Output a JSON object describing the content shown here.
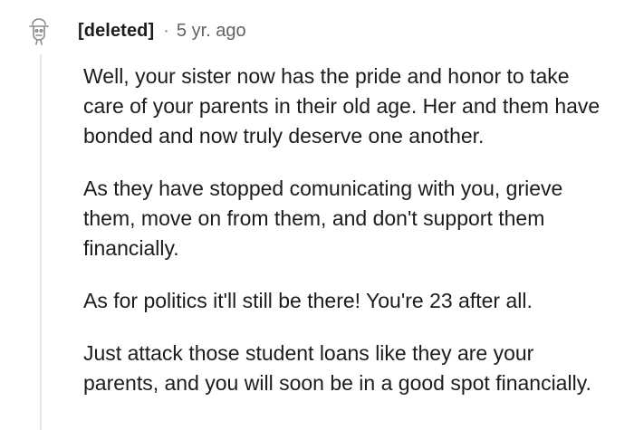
{
  "comment": {
    "author": "[deleted]",
    "separator": "·",
    "age": "5 yr. ago",
    "avatar_icon": "deleted-user-avatar-icon",
    "paragraphs": [
      "Well, your sister now has the pride and honor to take care of your parents in their old age. Her and them have bonded and now truly deserve one another.",
      "As they have stopped comunicating with you, grieve them, move on from them, and don't support them financially.",
      "As for politics it'll still be there! You're 23 after all.",
      "Just attack those student loans like they are your parents, and you will soon be in a good spot financially."
    ]
  }
}
